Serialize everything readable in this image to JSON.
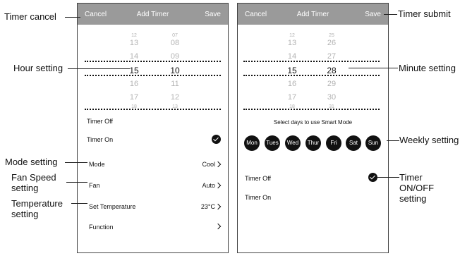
{
  "phone_left": {
    "header": {
      "cancel": "Cancel",
      "title": "Add Timer",
      "save": "Save"
    },
    "picker": {
      "hours": [
        "12",
        "13",
        "14",
        "15",
        "16",
        "17",
        "18"
      ],
      "minutes": [
        "07",
        "08",
        "09",
        "10",
        "11",
        "12",
        "13"
      ],
      "selected_hour": "15",
      "selected_minute": "10"
    },
    "timer_off": "Timer Off",
    "timer_on": "Timer On",
    "settings": [
      {
        "label": "Mode",
        "value": "Cool"
      },
      {
        "label": "Fan",
        "value": "Auto"
      },
      {
        "label": "Set Temperature",
        "value": "23°C"
      },
      {
        "label": "Function",
        "value": ""
      }
    ]
  },
  "phone_right": {
    "header": {
      "cancel": "Cancel",
      "title": "Add Timer",
      "save": "Save"
    },
    "picker": {
      "hours": [
        "12",
        "13",
        "14",
        "15",
        "16",
        "17",
        "18"
      ],
      "minutes": [
        "25",
        "26",
        "27",
        "28",
        "29",
        "30",
        "31"
      ],
      "selected_hour": "15",
      "selected_minute": "28"
    },
    "smart_mode_note": "Select days to use Smart Mode",
    "days": [
      "Mon",
      "Tues",
      "Wed",
      "Thur",
      "Fri",
      "Sat",
      "Sun"
    ],
    "timer_off": "Timer Off",
    "timer_on": "Timer On"
  },
  "annotations": {
    "timer_cancel": "Timer cancel",
    "hour_setting": "Hour setting",
    "mode_setting": "Mode setting",
    "fan_speed_setting": "Fan Speed setting",
    "temperature_setting": "Temperature setting",
    "timer_submit": "Timer submit",
    "minute_setting": "Minute setting",
    "weekly_setting": "Weekly setting",
    "timer_onoff_setting": "Timer ON/OFF setting"
  }
}
